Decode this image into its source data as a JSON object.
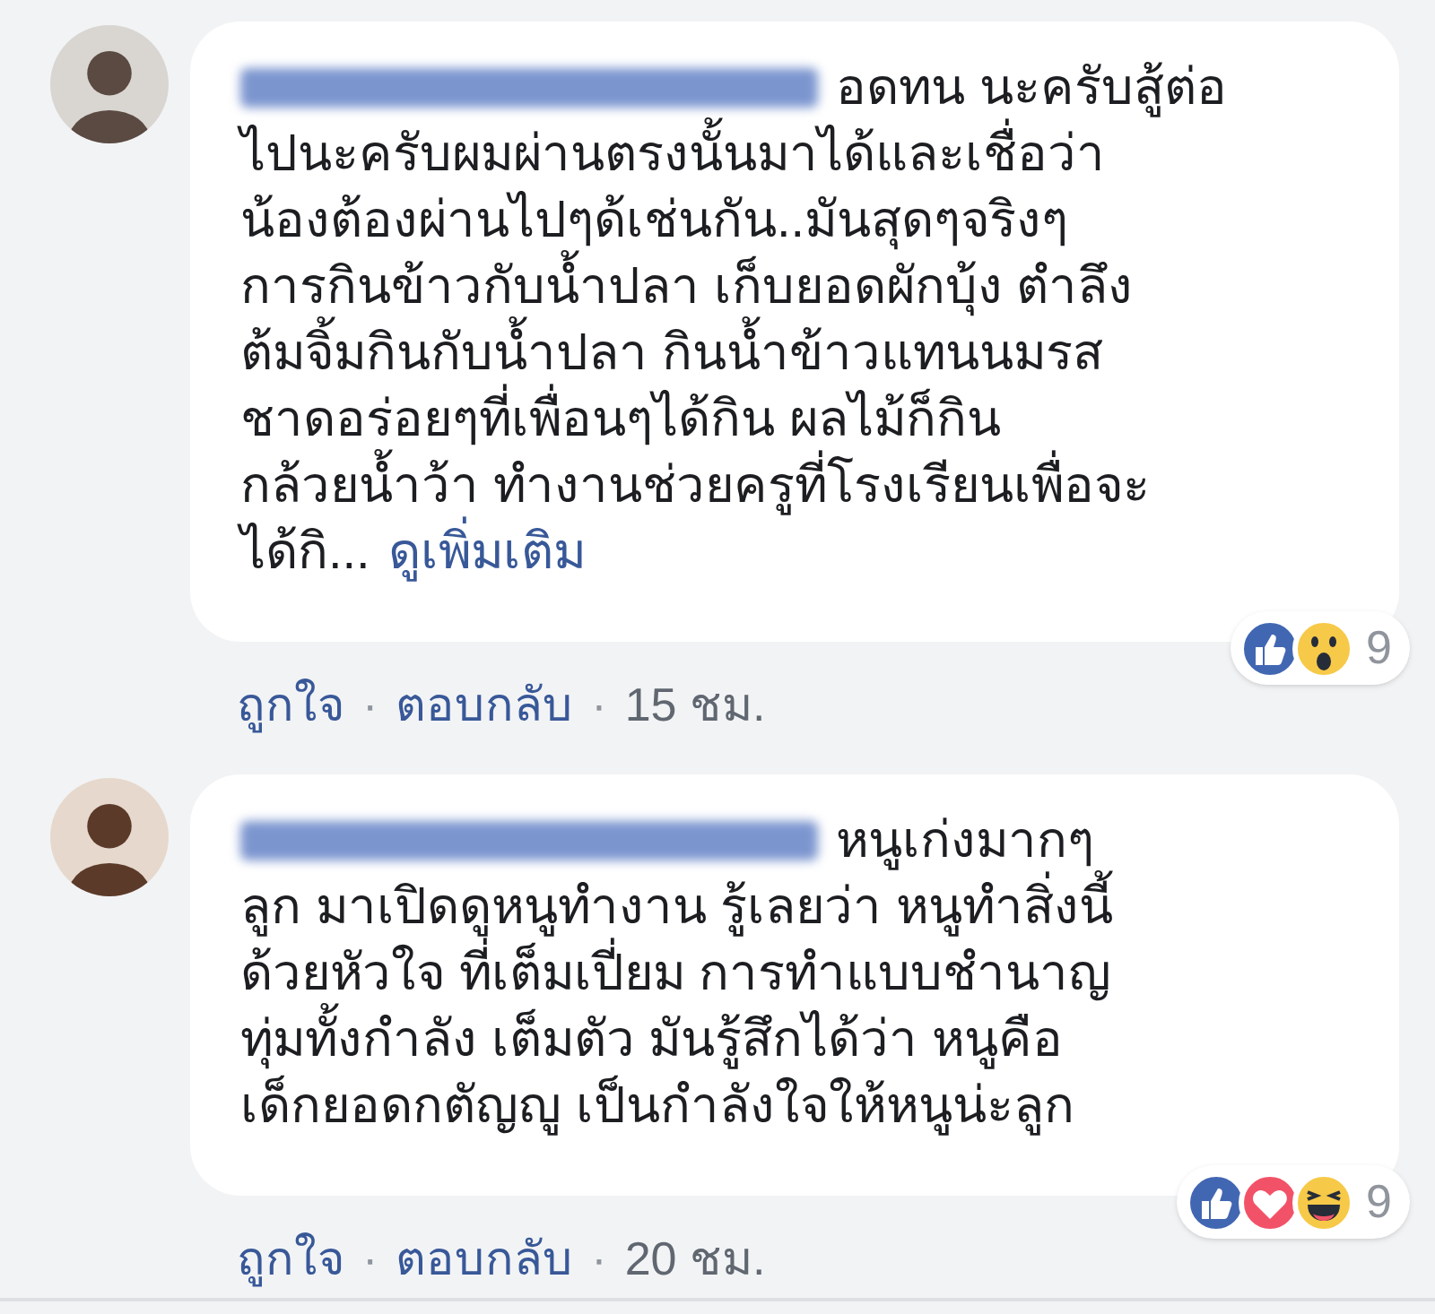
{
  "comments": [
    {
      "name_redacted": true,
      "first_line": "อดทน นะครับสู้ต่อ",
      "lines": [
        "ไปนะครับผมผ่านตรงนั้นมาได้และเชื่อว่า",
        "น้องต้องผ่านไปๆด้เช่นกัน..มันสุดๆจริงๆ",
        "การกินข้าวกับน้ำปลา เก็บยอดผักบุ้ง ตำลึง",
        "ต้มจิ้มกินกับน้ำปลา กินน้ำข้าวแทนนมรส",
        "ชาดอร่อยๆที่เพื่อนๆได้กิน ผลไม้ก็กิน",
        "กล้วยน้ำว้า ทำงานช่วยครูที่โรงเรียนเพื่อจะ"
      ],
      "last_line": "ได้กิ...",
      "see_more": "ดูเพิ่มเติม",
      "reactions": [
        {
          "kind": "like"
        },
        {
          "kind": "wow"
        }
      ],
      "reaction_count": "9",
      "like": "ถูกใจ",
      "separator": "·",
      "reply": "ตอบกลับ",
      "time": "15 ชม."
    },
    {
      "name_redacted": true,
      "first_line": "หนูเก่งมากๆ",
      "lines": [
        "ลูก มาเปิดดูหนูทำงาน รู้เลยว่า หนูทำสิ่งนี้",
        "ด้วยหัวใจ ที่เต็มเปี่ยม การทำแบบชำนาญ",
        "ทุ่มทั้งกำลัง เต็มตัว มันรู้สึกได้ว่า หนูคือ",
        "เด็กยอดกตัญญู เป็นกำลังใจให้หนูน่ะลูก"
      ],
      "reactions": [
        {
          "kind": "like"
        },
        {
          "kind": "love"
        },
        {
          "kind": "haha"
        }
      ],
      "reaction_count": "9",
      "like": "ถูกใจ",
      "separator": "·",
      "reply": "ตอบกลับ",
      "time": "20 ชม."
    }
  ]
}
